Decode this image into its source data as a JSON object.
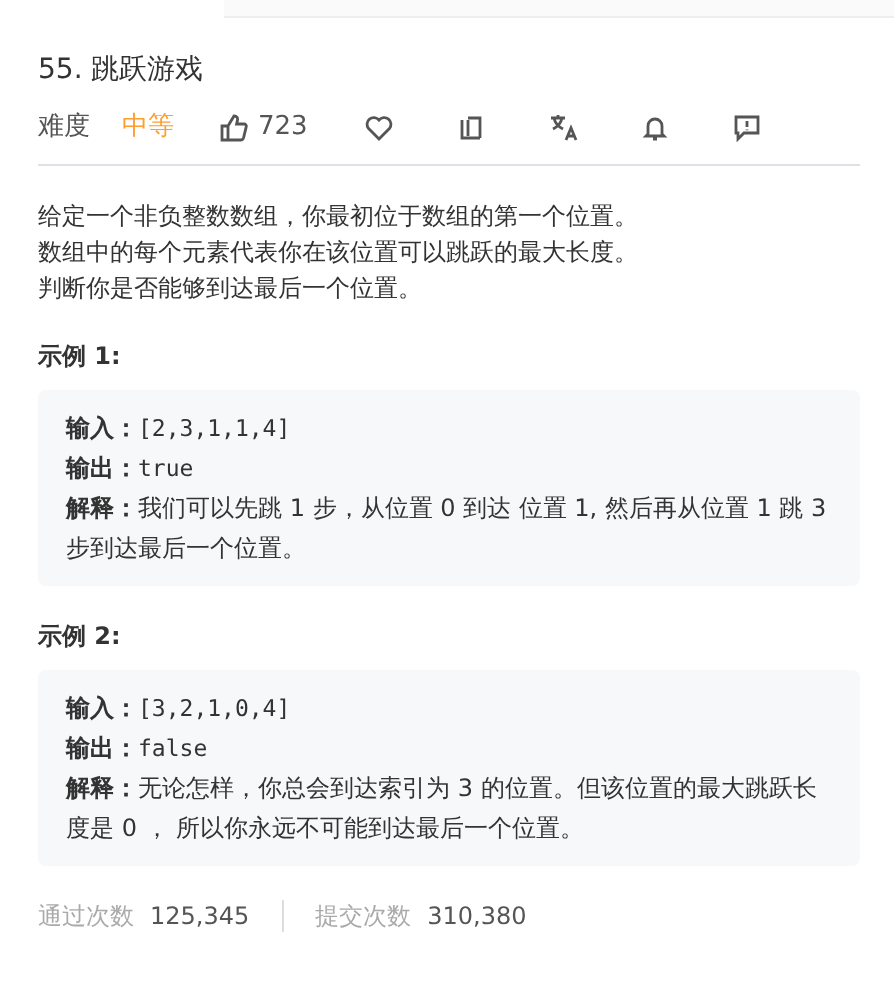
{
  "title": "55. 跳跃游戏",
  "meta": {
    "difficulty_label": "难度",
    "difficulty": "中等",
    "likes": "723"
  },
  "paragraphs": [
    "给定一个非负整数数组，你最初位于数组的第一个位置。",
    "数组中的每个元素代表你在该位置可以跳跃的最大长度。",
    "判断你是否能够到达最后一个位置。"
  ],
  "examples": [
    {
      "heading": "示例 1:",
      "lines": [
        {
          "label": "输入：",
          "value": "[2,3,1,1,4]",
          "kind": "code"
        },
        {
          "label": "输出：",
          "value": "true",
          "kind": "code"
        },
        {
          "label": "解释：",
          "value": "我们可以先跳 1 步，从位置 0 到达 位置 1, 然后再从位置 1 跳 3 步到达最后一个位置。",
          "kind": "text"
        }
      ]
    },
    {
      "heading": "示例 2:",
      "lines": [
        {
          "label": "输入：",
          "value": "[3,2,1,0,4]",
          "kind": "code"
        },
        {
          "label": "输出：",
          "value": "false",
          "kind": "code"
        },
        {
          "label": "解释：",
          "value": "无论怎样，你总会到达索引为 3 的位置。但该位置的最大跳跃长度是 0 ， 所以你永远不可能到达最后一个位置。",
          "kind": "text"
        }
      ]
    }
  ],
  "stats": [
    {
      "label": "通过次数",
      "value": "125,345"
    },
    {
      "label": "提交次数",
      "value": "310,380"
    }
  ]
}
